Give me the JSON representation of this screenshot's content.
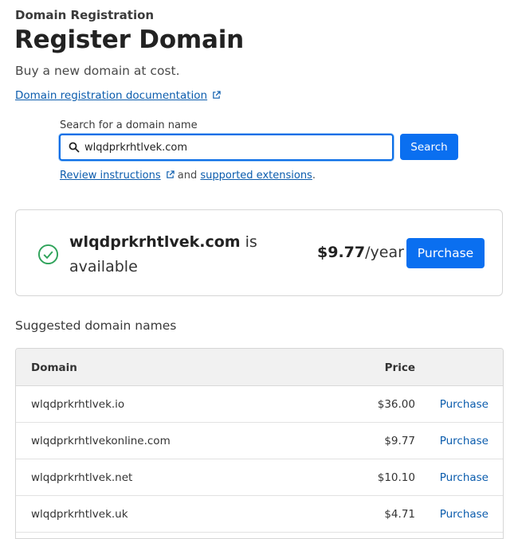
{
  "header": {
    "eyebrow": "Domain Registration",
    "title": "Register Domain",
    "subtitle": "Buy a new domain at cost.",
    "doc_link": "Domain registration documentation"
  },
  "search": {
    "label": "Search for a domain name",
    "value": "wlqdprkrhtlvek.com",
    "button": "Search",
    "help_link1": "Review instructions",
    "help_and": " and ",
    "help_link2": "supported extensions",
    "help_end": "."
  },
  "result": {
    "domain": "wlqdprkrhtlvek.com",
    "status": " is available",
    "price": "$9.77",
    "period": "/year",
    "button": "Purchase"
  },
  "suggestions": {
    "heading": "Suggested domain names",
    "columns": {
      "domain": "Domain",
      "price": "Price"
    },
    "rows": [
      {
        "domain": "wlqdprkrhtlvek.io",
        "price": "$36.00",
        "action": "Purchase"
      },
      {
        "domain": "wlqdprkrhtlvekonline.com",
        "price": "$9.77",
        "action": "Purchase"
      },
      {
        "domain": "wlqdprkrhtlvek.net",
        "price": "$10.10",
        "action": "Purchase"
      },
      {
        "domain": "wlqdprkrhtlvek.uk",
        "price": "$4.71",
        "action": "Purchase"
      }
    ]
  },
  "icons": {
    "external": "external-link-icon",
    "search": "magnifier-icon",
    "available": "check-circle-icon"
  },
  "colors": {
    "accent": "#0a6ff0",
    "link": "#0b5cad",
    "success": "#2fa35a"
  }
}
